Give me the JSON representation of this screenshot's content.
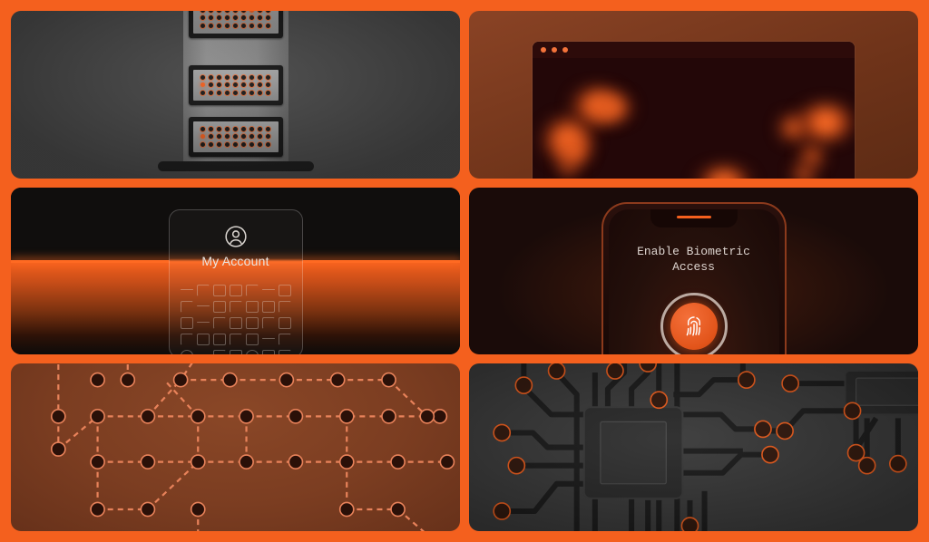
{
  "theme": {
    "background": "#f4601e",
    "accent": "#f4601e",
    "panel_dark": "#4a4a4a",
    "panel_rust": "#7b3d21",
    "panel_black": "#0d0b0a"
  },
  "panels": [
    {
      "id": "server-rack",
      "title": "Server Rack",
      "units": 3,
      "leds_per_unit": 27,
      "lit_led_index": [
        15,
        10,
        9
      ]
    },
    {
      "id": "activity-heatmap",
      "title": "Activity Heatmap",
      "window_dots": 3,
      "hotspots": 10
    },
    {
      "id": "account-scan",
      "title": "Account Scan",
      "card_label": "My Account",
      "avatar_icon": "user-circle-icon",
      "scanline": true
    },
    {
      "id": "biometric-prompt",
      "title": "Biometric Prompt",
      "heading_line1": "Enable Biometric",
      "heading_line2": "Access",
      "button_icon": "fingerprint-icon"
    },
    {
      "id": "network-graph",
      "title": "Network Graph",
      "nodes": 34,
      "edge_style": "dashed"
    },
    {
      "id": "circuit-board",
      "title": "Circuit Board",
      "chips": 2,
      "pads": 18
    }
  ],
  "account": {
    "card_label": "My Account",
    "avatar_icon": "user-circle-icon"
  },
  "biometric": {
    "line1": "Enable Biometric",
    "line2": "Access",
    "fingerprint_icon": "fingerprint-icon",
    "speaker_icon": "phone-speaker-bar"
  },
  "heatmap": {
    "dot1": "window-dot-red",
    "dot2": "window-dot-yellow",
    "dot3": "window-dot-green"
  }
}
